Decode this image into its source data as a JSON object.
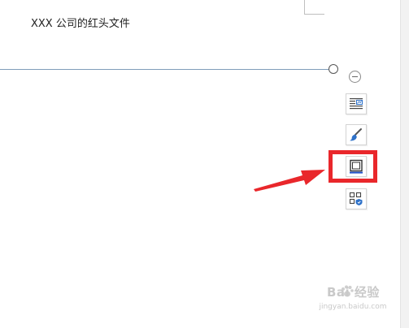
{
  "document": {
    "title_text": "XXX 公司的红头文件"
  },
  "float_toolbar": {
    "buttons": [
      {
        "icon": "layout-options-icon"
      },
      {
        "icon": "brush-style-icon"
      },
      {
        "icon": "border-frame-icon"
      },
      {
        "icon": "more-options-icon"
      }
    ],
    "highlighted_index": 2
  },
  "colors": {
    "highlight": "#e9272b",
    "line": "#7f9db9",
    "accent_blue": "#2f72c9"
  },
  "watermark": {
    "brand": "Bai 经验",
    "url": "jingyan.baidu.com"
  }
}
